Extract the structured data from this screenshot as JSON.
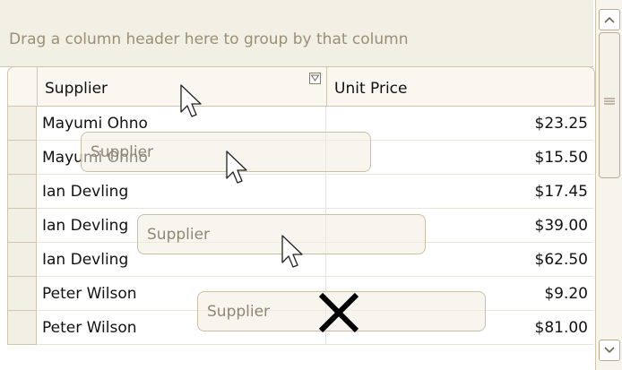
{
  "group_panel": {
    "hint": "Drag a column header here to group by that column"
  },
  "columns": [
    {
      "label": "Supplier"
    },
    {
      "label": "Unit Price"
    }
  ],
  "rows": [
    {
      "supplier": "Mayumi Ohno",
      "unit_price": "$23.25"
    },
    {
      "supplier": "Mayumi Ohno",
      "unit_price": "$15.50"
    },
    {
      "supplier": "Ian Devling",
      "unit_price": "$17.45"
    },
    {
      "supplier": "Ian Devling",
      "unit_price": "$39.00"
    },
    {
      "supplier": "Ian Devling",
      "unit_price": "$62.50"
    },
    {
      "supplier": "Peter Wilson",
      "unit_price": "$9.20"
    },
    {
      "supplier": "Peter Wilson",
      "unit_price": "$81.00"
    }
  ],
  "drag_ghosts": [
    {
      "label": "Supplier"
    },
    {
      "label": "Supplier"
    },
    {
      "label": "Supplier"
    }
  ],
  "icons": {
    "filter": "filter-icon",
    "cursor": "arrow-cursor-icon",
    "no_drop": "no-drop-x-icon",
    "scroll_up": "chevron-up-icon",
    "scroll_down": "chevron-down-icon"
  }
}
